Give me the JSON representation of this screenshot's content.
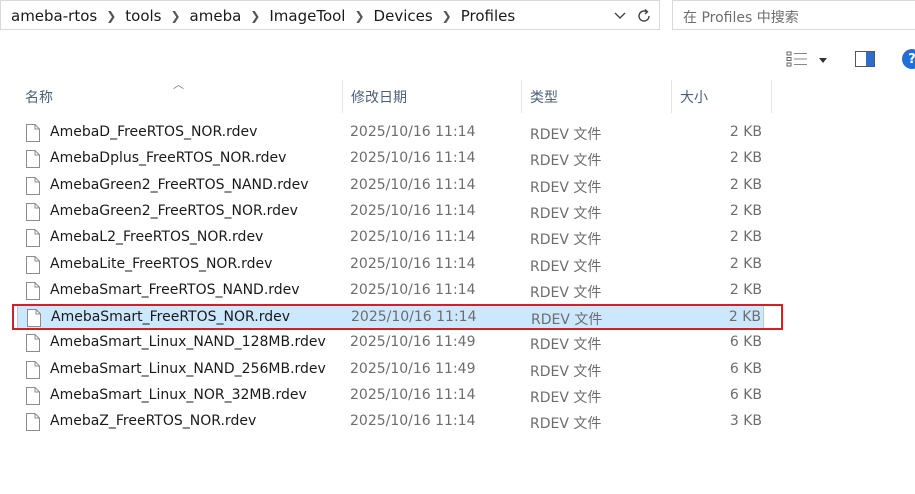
{
  "breadcrumb": [
    "ameba-rtos",
    "tools",
    "ameba",
    "ImageTool",
    "Devices",
    "Profiles"
  ],
  "search": {
    "placeholder": "在 Profiles 中搜索"
  },
  "columns": {
    "name": "名称",
    "date": "修改日期",
    "type": "类型",
    "size": "大小"
  },
  "sort": {
    "column": "name",
    "direction": "ascending"
  },
  "selected_index": 7,
  "colors": {
    "selection_bg": "#cce8ff",
    "selection_border": "#99d1ff",
    "highlight": "#d0202a"
  },
  "files": [
    {
      "name": "AmebaD_FreeRTOS_NOR.rdev",
      "date": "2025/10/16 11:14",
      "type": "RDEV 文件",
      "size": "2 KB"
    },
    {
      "name": "AmebaDplus_FreeRTOS_NOR.rdev",
      "date": "2025/10/16 11:14",
      "type": "RDEV 文件",
      "size": "2 KB"
    },
    {
      "name": "AmebaGreen2_FreeRTOS_NAND.rdev",
      "date": "2025/10/16 11:14",
      "type": "RDEV 文件",
      "size": "2 KB"
    },
    {
      "name": "AmebaGreen2_FreeRTOS_NOR.rdev",
      "date": "2025/10/16 11:14",
      "type": "RDEV 文件",
      "size": "2 KB"
    },
    {
      "name": "AmebaL2_FreeRTOS_NOR.rdev",
      "date": "2025/10/16 11:14",
      "type": "RDEV 文件",
      "size": "2 KB"
    },
    {
      "name": "AmebaLite_FreeRTOS_NOR.rdev",
      "date": "2025/10/16 11:14",
      "type": "RDEV 文件",
      "size": "2 KB"
    },
    {
      "name": "AmebaSmart_FreeRTOS_NAND.rdev",
      "date": "2025/10/16 11:14",
      "type": "RDEV 文件",
      "size": "2 KB"
    },
    {
      "name": "AmebaSmart_FreeRTOS_NOR.rdev",
      "date": "2025/10/16 11:14",
      "type": "RDEV 文件",
      "size": "2 KB"
    },
    {
      "name": "AmebaSmart_Linux_NAND_128MB.rdev",
      "date": "2025/10/16 11:49",
      "type": "RDEV 文件",
      "size": "6 KB"
    },
    {
      "name": "AmebaSmart_Linux_NAND_256MB.rdev",
      "date": "2025/10/16 11:49",
      "type": "RDEV 文件",
      "size": "6 KB"
    },
    {
      "name": "AmebaSmart_Linux_NOR_32MB.rdev",
      "date": "2025/10/16 11:14",
      "type": "RDEV 文件",
      "size": "6 KB"
    },
    {
      "name": "AmebaZ_FreeRTOS_NOR.rdev",
      "date": "2025/10/16 11:14",
      "type": "RDEV 文件",
      "size": "3 KB"
    }
  ]
}
